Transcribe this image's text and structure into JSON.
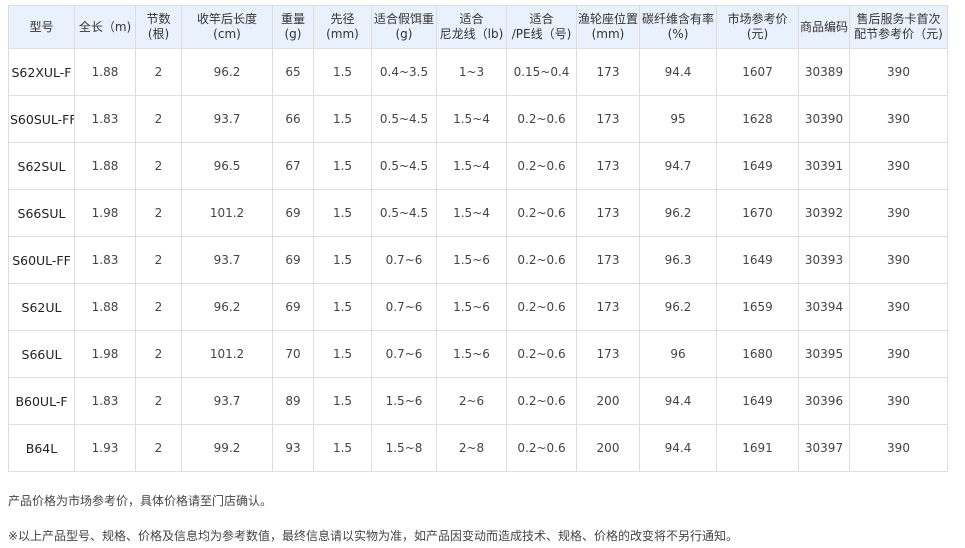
{
  "table": {
    "columns": [
      "型号",
      "全长（m)",
      "节数(根)",
      "收竿后长度\n(cm)",
      "重量(g)",
      "先径 (mm)",
      "适合假饵重\n(g)",
      "适合\n尼龙线（lb)",
      "适合\n/PE线（号)",
      "渔轮座位置\n(mm)",
      "碳纤维含有率\n(%)",
      "市场参考价(元)",
      "商品编码",
      "售后服务卡首次\n配节参考价（元)"
    ],
    "rows": [
      [
        "S62XUL-F",
        "1.88",
        "2",
        "96.2",
        "65",
        "1.5",
        "0.4~3.5",
        "1~3",
        "0.15~0.4",
        "173",
        "94.4",
        "1607",
        "30389",
        "390"
      ],
      [
        "S60SUL-FF",
        "1.83",
        "2",
        "93.7",
        "66",
        "1.5",
        "0.5~4.5",
        "1.5~4",
        "0.2~0.6",
        "173",
        "95",
        "1628",
        "30390",
        "390"
      ],
      [
        "S62SUL",
        "1.88",
        "2",
        "96.5",
        "67",
        "1.5",
        "0.5~4.5",
        "1.5~4",
        "0.2~0.6",
        "173",
        "94.7",
        "1649",
        "30391",
        "390"
      ],
      [
        "S66SUL",
        "1.98",
        "2",
        "101.2",
        "69",
        "1.5",
        "0.5~4.5",
        "1.5~4",
        "0.2~0.6",
        "173",
        "96.2",
        "1670",
        "30392",
        "390"
      ],
      [
        "S60UL-FF",
        "1.83",
        "2",
        "93.7",
        "69",
        "1.5",
        "0.7~6",
        "1.5~6",
        "0.2~0.6",
        "173",
        "96.3",
        "1649",
        "30393",
        "390"
      ],
      [
        "S62UL",
        "1.88",
        "2",
        "96.2",
        "69",
        "1.5",
        "0.7~6",
        "1.5~6",
        "0.2~0.6",
        "173",
        "96.2",
        "1659",
        "30394",
        "390"
      ],
      [
        "S66UL",
        "1.98",
        "2",
        "101.2",
        "70",
        "1.5",
        "0.7~6",
        "1.5~6",
        "0.2~0.6",
        "173",
        "96",
        "1680",
        "30395",
        "390"
      ],
      [
        "B60UL-F",
        "1.83",
        "2",
        "93.7",
        "89",
        "1.5",
        "1.5~6",
        "2~6",
        "0.2~0.6",
        "200",
        "94.4",
        "1649",
        "30396",
        "390"
      ],
      [
        "B64L",
        "1.93",
        "2",
        "99.2",
        "93",
        "1.5",
        "1.5~8",
        "2~8",
        "0.2~0.6",
        "200",
        "94.4",
        "1691",
        "30397",
        "390"
      ]
    ]
  },
  "notes": {
    "price_note": "产品价格为市场参考价，具体价格请至门店确认。",
    "disclaimer": "※以上产品型号、规格、价格及信息均为参考数值，最终信息请以实物为准，如产品因变动而造成技术、规格、价格的改变将不另行通知。"
  },
  "colors": {
    "header_background": "#e9f1fc",
    "border": "#dddddd",
    "text": "#333333"
  }
}
